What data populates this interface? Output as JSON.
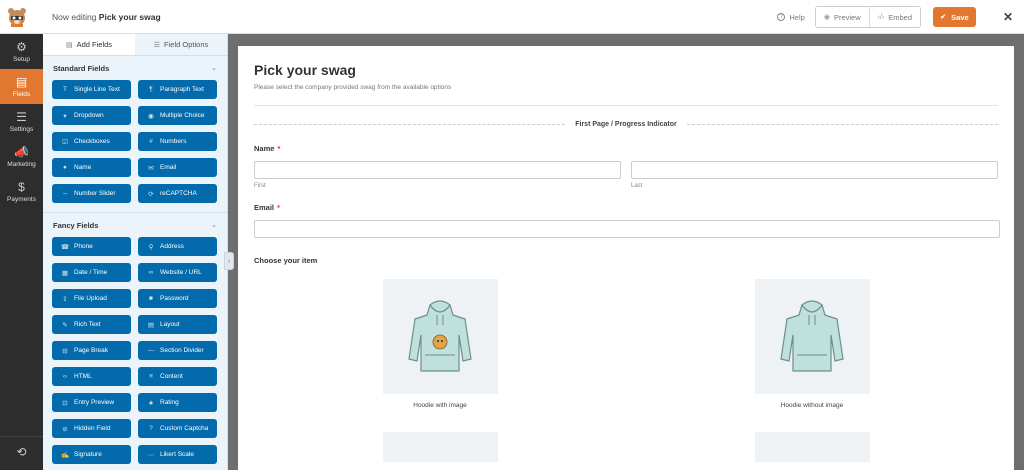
{
  "header": {
    "prefix": "Now editing",
    "form_name": "Pick your swag",
    "help_label": "Help",
    "preview_label": "Preview",
    "embed_label": "Embed",
    "save_label": "Save"
  },
  "nav": {
    "items": [
      {
        "label": "Setup",
        "icon": "gear-icon"
      },
      {
        "label": "Fields",
        "icon": "fields-icon"
      },
      {
        "label": "Settings",
        "icon": "sliders-icon"
      },
      {
        "label": "Marketing",
        "icon": "megaphone-icon"
      },
      {
        "label": "Payments",
        "icon": "dollar-icon"
      }
    ],
    "active": "Fields"
  },
  "panel": {
    "tab_add": "Add Fields",
    "tab_options": "Field Options",
    "standard_title": "Standard Fields",
    "standard": [
      {
        "label": "Single Line Text",
        "icon": "T"
      },
      {
        "label": "Paragraph Text",
        "icon": "¶"
      },
      {
        "label": "Dropdown",
        "icon": "▾"
      },
      {
        "label": "Multiple Choice",
        "icon": "◉"
      },
      {
        "label": "Checkboxes",
        "icon": "☑"
      },
      {
        "label": "Numbers",
        "icon": "#"
      },
      {
        "label": "Name",
        "icon": "●"
      },
      {
        "label": "Email",
        "icon": "✉"
      },
      {
        "label": "Number Slider",
        "icon": "⇔"
      },
      {
        "label": "reCAPTCHA",
        "icon": "⟳"
      }
    ],
    "fancy_title": "Fancy Fields",
    "fancy": [
      {
        "label": "Phone",
        "icon": "☎"
      },
      {
        "label": "Address",
        "icon": "⚲"
      },
      {
        "label": "Date / Time",
        "icon": "▦"
      },
      {
        "label": "Website / URL",
        "icon": "∞"
      },
      {
        "label": "File Upload",
        "icon": "⇪"
      },
      {
        "label": "Password",
        "icon": "■"
      },
      {
        "label": "Rich Text",
        "icon": "✎"
      },
      {
        "label": "Layout",
        "icon": "▤"
      },
      {
        "label": "Page Break",
        "icon": "⊟"
      },
      {
        "label": "Section Divider",
        "icon": "—"
      },
      {
        "label": "HTML",
        "icon": "‹›"
      },
      {
        "label": "Content",
        "icon": "≡"
      },
      {
        "label": "Entry Preview",
        "icon": "⊡"
      },
      {
        "label": "Rating",
        "icon": "★"
      },
      {
        "label": "Hidden Field",
        "icon": "⊘"
      },
      {
        "label": "Custom Captcha",
        "icon": "?"
      },
      {
        "label": "Signature",
        "icon": "✍"
      },
      {
        "label": "Likert Scale",
        "icon": "⋯"
      }
    ]
  },
  "form": {
    "title": "Pick your swag",
    "description": "Please select the company provided swag from the available options",
    "page_indicator": "First Page / Progress Indicator",
    "name_label": "Name",
    "first_sub": "First",
    "last_sub": "Last",
    "email_label": "Email",
    "item_label": "Choose your item",
    "items": [
      {
        "caption": "Hoodie with image"
      },
      {
        "caption": "Hoodie without image"
      }
    ]
  },
  "colors": {
    "accent": "#e27730",
    "field_button": "#036aab",
    "nav_bg": "#2d2d2d",
    "panel_bg": "#ebf3fb",
    "hoodie": "#bfe0dc"
  }
}
